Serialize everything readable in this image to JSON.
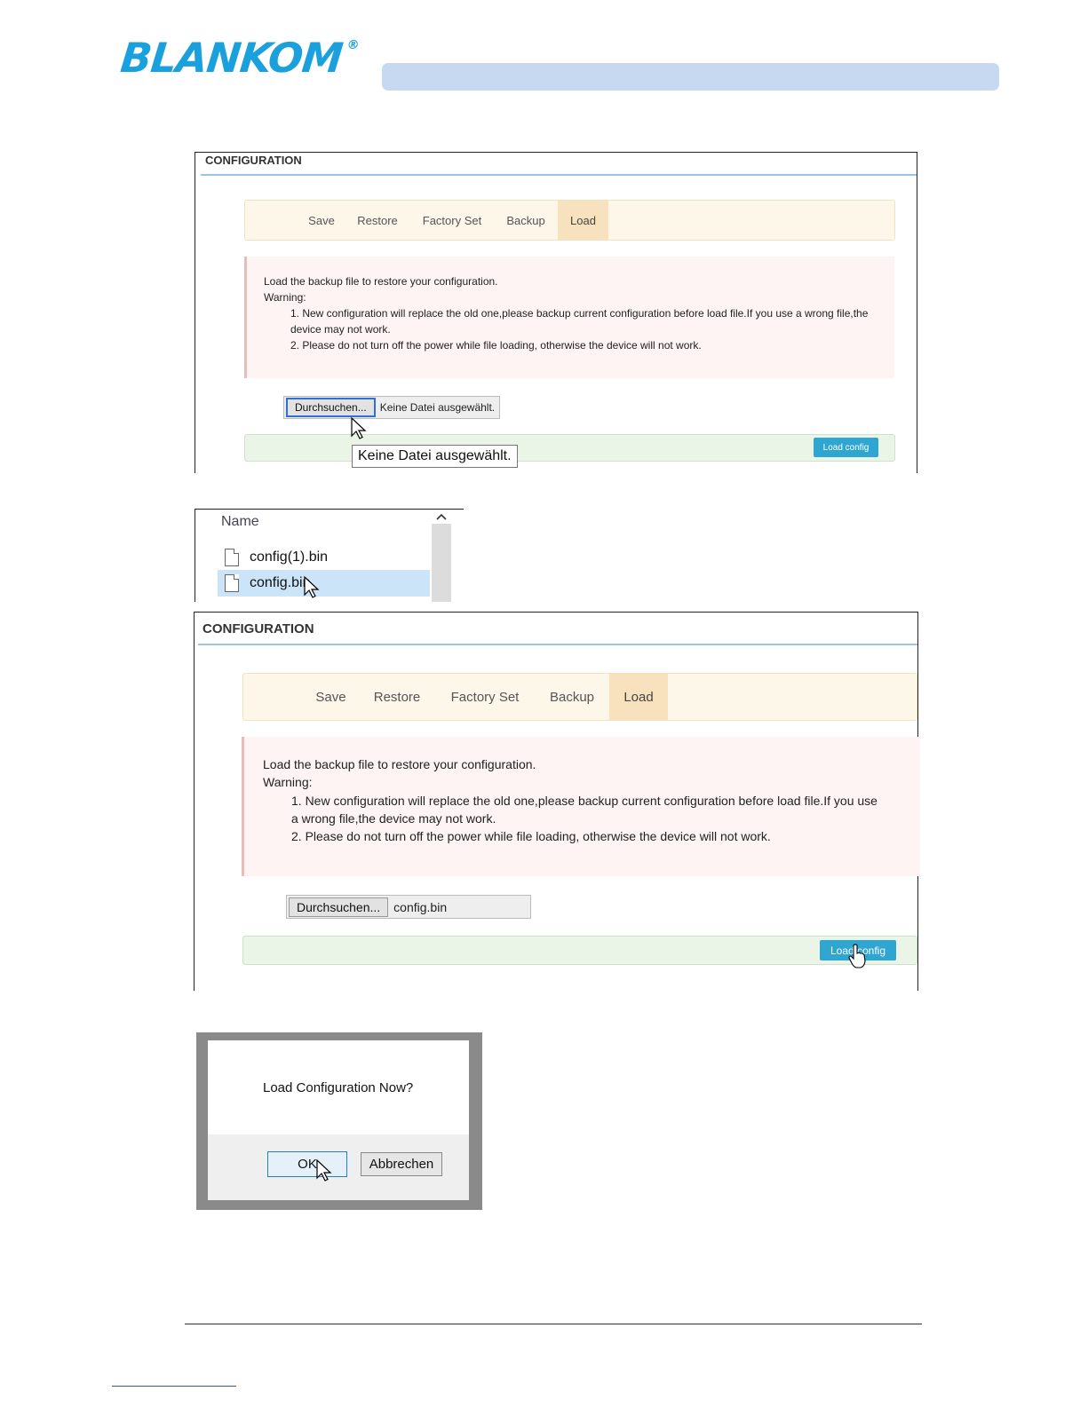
{
  "header": {
    "logo_text": "BLANKOM",
    "logo_registered": "®",
    "bar_color": "#c6d9f0",
    "brand_color": "#1aa0dc"
  },
  "panel1": {
    "title": "CONFIGURATION",
    "tabs": [
      {
        "label": "Save"
      },
      {
        "label": "Restore"
      },
      {
        "label": "Factory Set"
      },
      {
        "label": "Backup"
      },
      {
        "label": "Load",
        "active": true
      }
    ],
    "warning": {
      "intro": "Load the backup file to restore your configuration.",
      "heading": "Warning:",
      "item1": "1. New configuration will replace the old one,please backup current configuration before load file.If you use a wrong file,the device may not work.",
      "item2": "2. Please do not turn off the power while file loading, otherwise the device will not work."
    },
    "browse_label": "Durchsuchen...",
    "file_status": "Keine Datei ausgewählt.",
    "tooltip": "Keine Datei ausgewählt.",
    "load_button": "Load config"
  },
  "picker": {
    "column_header": "Name",
    "files": [
      "config(1).bin",
      "config.bin"
    ],
    "selected": "config.bin"
  },
  "panel2": {
    "title": "CONFIGURATION",
    "tabs": [
      {
        "label": "Save"
      },
      {
        "label": "Restore"
      },
      {
        "label": "Factory Set"
      },
      {
        "label": "Backup"
      },
      {
        "label": "Load",
        "active": true
      }
    ],
    "warning": {
      "intro": "Load the backup file to restore your configuration.",
      "heading": "Warning:",
      "item1": "1. New configuration will replace the old one,please backup current configuration before load file.If you use a wrong file,the device may not work.",
      "item2": "2. Please do not turn off the power while file loading, otherwise the device will not work."
    },
    "browse_label": "Durchsuchen...",
    "file_status": "config.bin",
    "load_button": "Load config"
  },
  "dialog": {
    "message": "Load Configuration Now?",
    "ok_label": "OK",
    "cancel_label": "Abbrechen"
  }
}
